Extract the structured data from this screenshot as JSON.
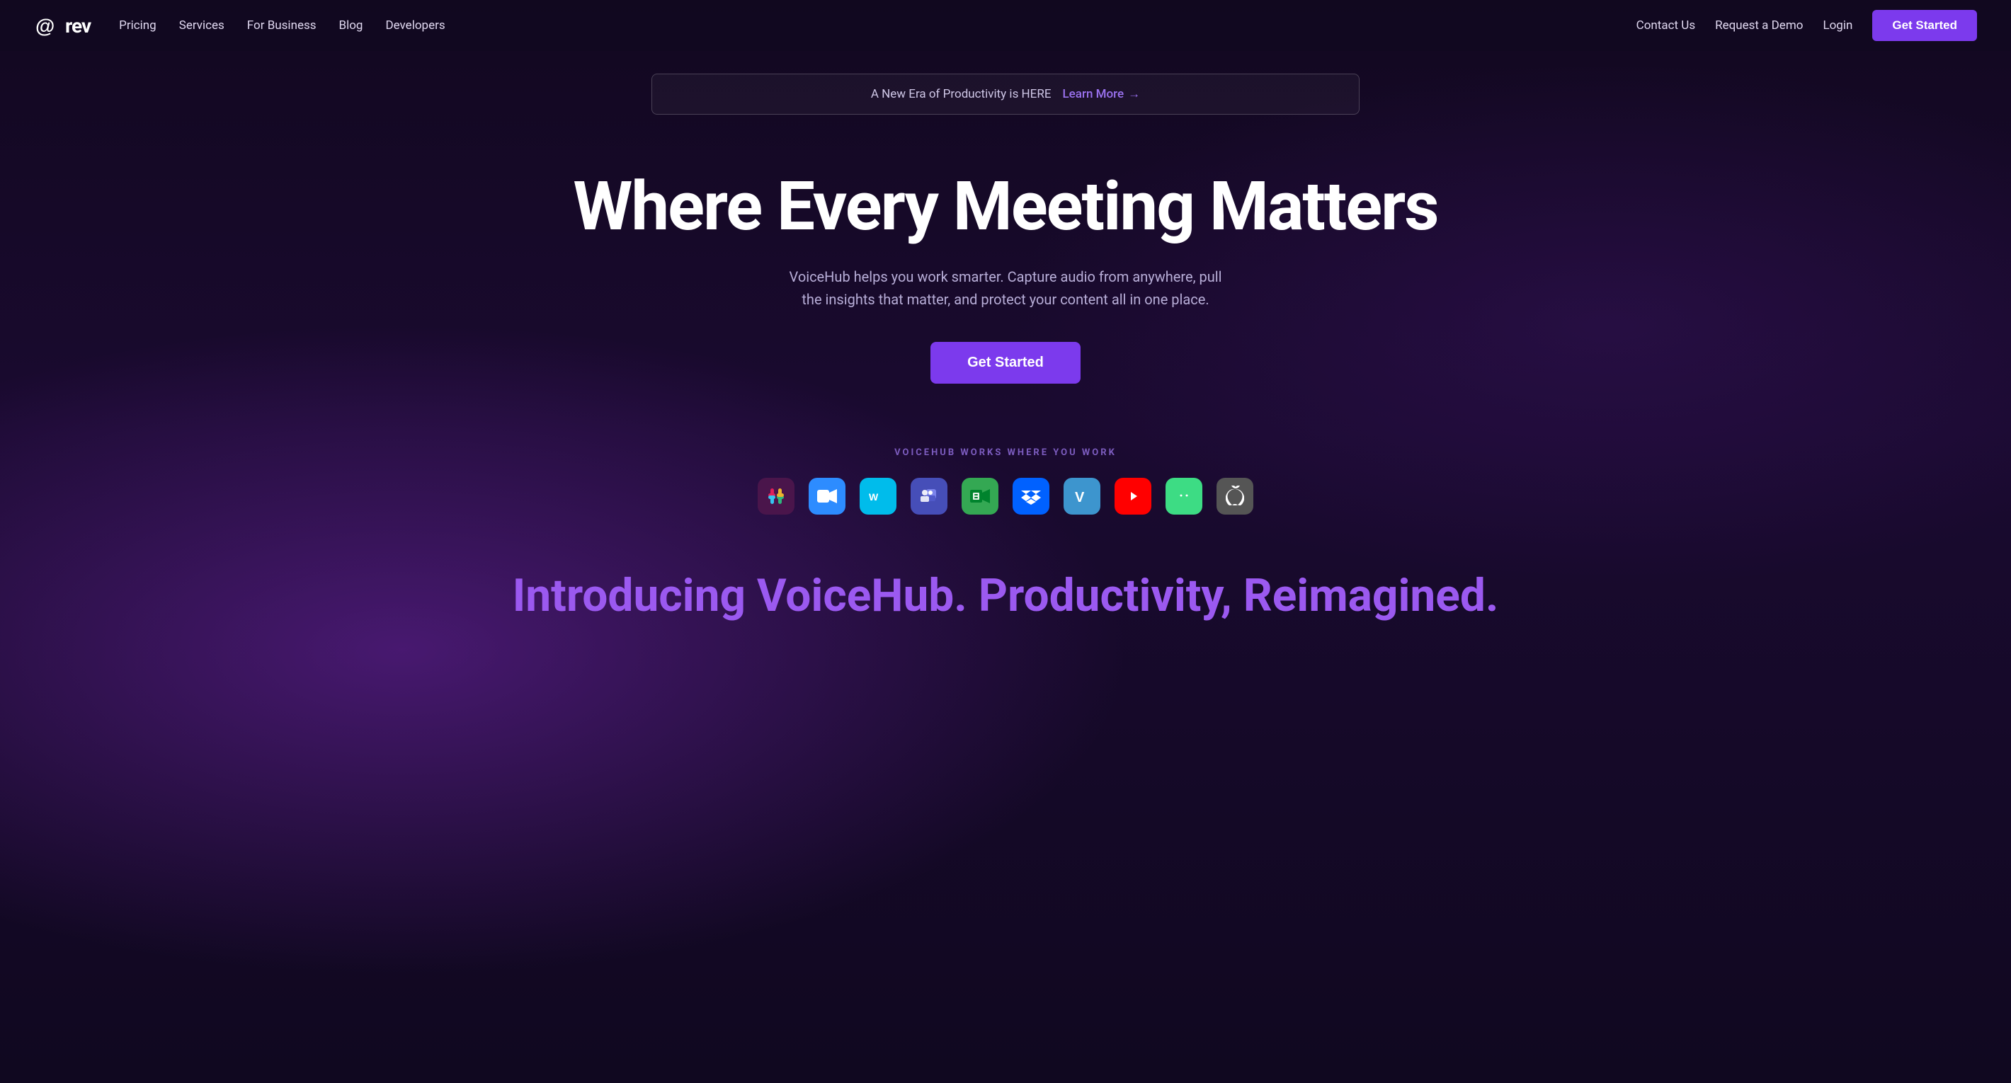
{
  "nav": {
    "logo_text": "rev",
    "links": [
      {
        "label": "Pricing",
        "href": "#"
      },
      {
        "label": "Services",
        "href": "#"
      },
      {
        "label": "For Business",
        "href": "#"
      },
      {
        "label": "Blog",
        "href": "#"
      },
      {
        "label": "Developers",
        "href": "#"
      }
    ],
    "right_links": [
      {
        "label": "Contact Us",
        "href": "#"
      },
      {
        "label": "Request a Demo",
        "href": "#"
      },
      {
        "label": "Login",
        "href": "#"
      }
    ],
    "cta_label": "Get Started"
  },
  "announcement": {
    "text": "A New Era of Productivity is HERE",
    "link_text": "Learn More",
    "link_arrow": "→"
  },
  "hero": {
    "title": "Where Every Meeting Matters",
    "subtitle": "VoiceHub helps you work smarter. Capture audio from anywhere, pull the insights that matter, and protect your content all in one place.",
    "cta_label": "Get Started"
  },
  "integrations": {
    "label": "VOICEHUB WORKS WHERE YOU WORK",
    "icons": [
      {
        "name": "slack",
        "label": "Slack",
        "class": "icon-slack"
      },
      {
        "name": "zoom",
        "label": "Zoom",
        "class": "icon-zoom"
      },
      {
        "name": "webex",
        "label": "Webex",
        "class": "icon-webex"
      },
      {
        "name": "teams",
        "label": "Microsoft Teams",
        "class": "icon-teams"
      },
      {
        "name": "meet",
        "label": "Google Meet",
        "class": "icon-meet"
      },
      {
        "name": "dropbox",
        "label": "Dropbox",
        "class": "icon-dropbox"
      },
      {
        "name": "venmo",
        "label": "Venmo",
        "class": "icon-venmo"
      },
      {
        "name": "youtube",
        "label": "YouTube",
        "class": "icon-youtube"
      },
      {
        "name": "android",
        "label": "Android",
        "class": "icon-android"
      },
      {
        "name": "apple",
        "label": "Apple",
        "class": "icon-apple"
      }
    ]
  },
  "bottom": {
    "introducing_text": "Introducing VoiceHub. Productivity, Reimagined."
  }
}
